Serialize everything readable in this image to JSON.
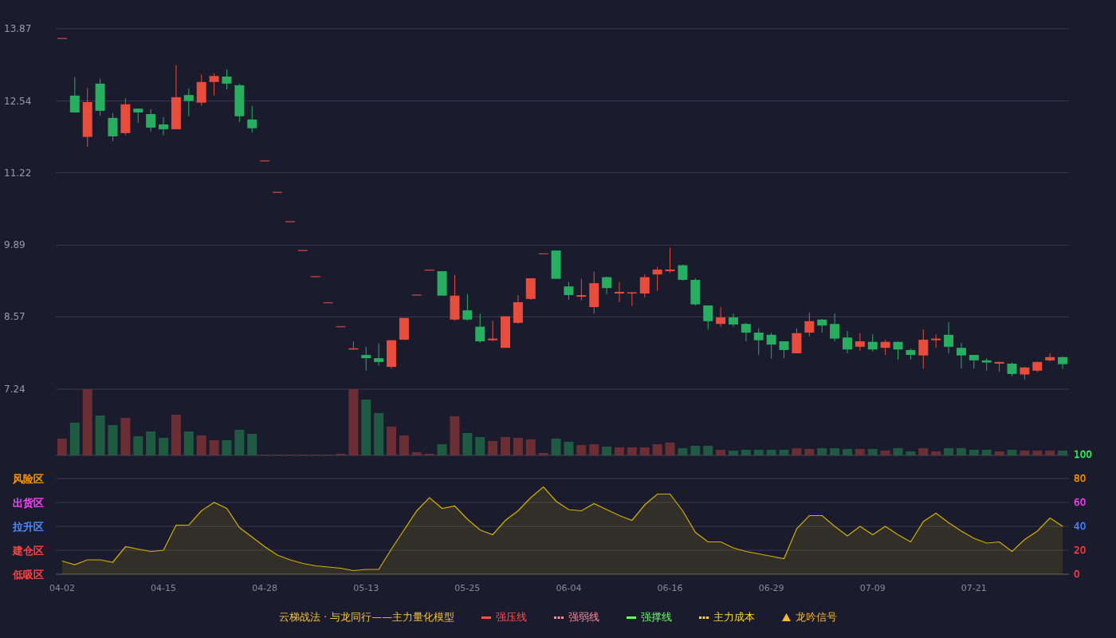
{
  "price_chart": {
    "chart_data": {
      "type": "candlestick",
      "grid": true,
      "ylim": [
        7.24,
        13.87
      ],
      "yticks": [
        {
          "value": 13.87,
          "label": "13.87"
        },
        {
          "value": 12.54,
          "label": "12.54"
        },
        {
          "value": 11.22,
          "label": "11.22"
        },
        {
          "value": 9.89,
          "label": "9.89"
        },
        {
          "value": 8.57,
          "label": "8.57"
        },
        {
          "value": 7.24,
          "label": "7.24"
        }
      ],
      "categories": [
        null,
        null,
        null,
        null,
        null,
        null,
        null,
        null,
        null,
        null,
        null,
        null,
        null,
        null,
        null,
        null,
        null,
        null,
        null,
        null,
        null,
        null,
        null,
        null,
        null,
        null,
        null,
        null,
        null,
        null,
        null,
        null,
        null,
        null,
        null,
        null,
        null,
        null,
        null,
        null,
        null,
        null,
        null,
        null,
        null,
        null,
        null,
        null,
        null,
        null,
        null,
        null,
        null,
        null,
        null,
        null,
        null,
        null,
        null,
        null,
        null,
        null,
        null,
        null,
        null,
        null,
        null,
        null,
        null,
        null,
        null,
        null,
        null,
        null,
        null,
        null,
        null,
        null,
        null,
        null
      ],
      "ohlc": [
        [
          13.69,
          13.69,
          13.69,
          13.69
        ],
        [
          12.64,
          12.98,
          12.32,
          12.33
        ],
        [
          11.88,
          12.78,
          11.7,
          12.52
        ],
        [
          12.86,
          12.95,
          12.27,
          12.36
        ],
        [
          12.23,
          12.32,
          11.8,
          11.89
        ],
        [
          11.95,
          12.59,
          11.91,
          12.48
        ],
        [
          12.4,
          12.4,
          12.14,
          12.33
        ],
        [
          12.3,
          12.39,
          11.98,
          12.05
        ],
        [
          12.11,
          12.24,
          11.91,
          12.02
        ],
        [
          12.02,
          13.2,
          12.02,
          12.61
        ],
        [
          12.65,
          12.77,
          12.26,
          12.54
        ],
        [
          12.51,
          13.03,
          12.45,
          12.89
        ],
        [
          12.89,
          13.05,
          12.64,
          13.0
        ],
        [
          12.99,
          13.12,
          12.75,
          12.86
        ],
        [
          12.83,
          12.86,
          12.15,
          12.26
        ],
        [
          12.2,
          12.45,
          11.96,
          12.04
        ],
        [
          11.44,
          11.44,
          11.44,
          11.44
        ],
        [
          10.86,
          10.86,
          10.86,
          10.86
        ],
        [
          10.32,
          10.32,
          10.32,
          10.32
        ],
        [
          9.79,
          9.79,
          9.79,
          9.79
        ],
        [
          9.31,
          9.31,
          9.31,
          9.31
        ],
        [
          8.83,
          8.83,
          8.83,
          8.83
        ],
        [
          8.39,
          8.39,
          8.39,
          8.39
        ],
        [
          7.97,
          8.12,
          7.97,
          7.99
        ],
        [
          7.87,
          8.02,
          7.58,
          7.81
        ],
        [
          7.81,
          8.08,
          7.67,
          7.74
        ],
        [
          7.65,
          8.14,
          7.62,
          8.14
        ],
        [
          8.15,
          8.55,
          8.14,
          8.55
        ],
        [
          8.97,
          8.97,
          8.97,
          8.97
        ],
        [
          9.43,
          9.43,
          9.43,
          9.43
        ],
        [
          9.41,
          9.41,
          8.96,
          8.96
        ],
        [
          8.52,
          9.34,
          8.5,
          8.96
        ],
        [
          8.69,
          8.99,
          8.5,
          8.52
        ],
        [
          8.39,
          8.63,
          8.09,
          8.12
        ],
        [
          8.14,
          8.5,
          8.12,
          8.17
        ],
        [
          8.0,
          8.58,
          8.0,
          8.58
        ],
        [
          8.46,
          8.97,
          8.44,
          8.84
        ],
        [
          8.9,
          9.28,
          8.88,
          9.28
        ],
        [
          9.73,
          9.73,
          9.73,
          9.73
        ],
        [
          9.79,
          9.79,
          9.27,
          9.27
        ],
        [
          9.13,
          9.21,
          8.88,
          8.97
        ],
        [
          8.94,
          9.27,
          8.87,
          8.97
        ],
        [
          8.75,
          9.4,
          8.63,
          9.19
        ],
        [
          9.3,
          9.31,
          8.99,
          9.1
        ],
        [
          9.0,
          9.21,
          8.84,
          9.03
        ],
        [
          9.0,
          9.03,
          8.77,
          9.02
        ],
        [
          9.0,
          9.35,
          8.93,
          9.3
        ],
        [
          9.35,
          9.49,
          9.05,
          9.44
        ],
        [
          9.41,
          9.84,
          9.38,
          9.44
        ],
        [
          9.52,
          9.53,
          9.24,
          9.25
        ],
        [
          9.25,
          9.28,
          8.78,
          8.8
        ],
        [
          8.78,
          8.78,
          8.34,
          8.49
        ],
        [
          8.44,
          8.75,
          8.39,
          8.56
        ],
        [
          8.56,
          8.63,
          8.39,
          8.43
        ],
        [
          8.44,
          8.46,
          8.12,
          8.28
        ],
        [
          8.28,
          8.36,
          7.87,
          8.14
        ],
        [
          8.24,
          8.28,
          7.8,
          8.06
        ],
        [
          8.12,
          8.12,
          7.81,
          7.96
        ],
        [
          7.9,
          8.36,
          7.9,
          8.27
        ],
        [
          8.28,
          8.65,
          8.21,
          8.49
        ],
        [
          8.52,
          8.53,
          8.28,
          8.41
        ],
        [
          8.44,
          8.63,
          8.12,
          8.17
        ],
        [
          8.19,
          8.31,
          7.9,
          7.97
        ],
        [
          8.02,
          8.27,
          7.95,
          8.12
        ],
        [
          8.11,
          8.25,
          7.93,
          7.97
        ],
        [
          8.0,
          8.15,
          7.87,
          8.11
        ],
        [
          8.11,
          8.12,
          7.78,
          7.97
        ],
        [
          7.96,
          7.99,
          7.78,
          7.87
        ],
        [
          7.86,
          8.34,
          7.62,
          8.15
        ],
        [
          8.14,
          8.25,
          8.0,
          8.17
        ],
        [
          8.24,
          8.47,
          7.9,
          8.02
        ],
        [
          8.0,
          8.09,
          7.62,
          7.86
        ],
        [
          7.87,
          7.87,
          7.62,
          7.77
        ],
        [
          7.77,
          7.81,
          7.58,
          7.73
        ],
        [
          7.71,
          7.75,
          7.56,
          7.74
        ],
        [
          7.71,
          7.73,
          7.48,
          7.52
        ],
        [
          7.51,
          7.65,
          7.42,
          7.64
        ],
        [
          7.58,
          7.75,
          7.55,
          7.74
        ],
        [
          7.77,
          7.9,
          7.75,
          7.83
        ],
        [
          7.83,
          7.84,
          7.61,
          7.7
        ]
      ]
    }
  },
  "indicator_chart": {
    "zones": [
      {
        "label": "风险区",
        "color": "#ff9900"
      },
      {
        "label": "出货区",
        "color": "#ff44ff"
      },
      {
        "label": "拉升区",
        "color": "#4d8cff"
      },
      {
        "label": "建仓区",
        "color": "#ff4444"
      },
      {
        "label": "低吸区",
        "color": "#ff4444"
      }
    ],
    "chart_data": {
      "type": "area",
      "grid": true,
      "ylim": [
        0,
        100
      ],
      "yticks": [
        {
          "value": 100,
          "label": "100"
        },
        {
          "value": 80,
          "label": "80"
        },
        {
          "value": 60,
          "label": "60"
        },
        {
          "value": 40,
          "label": "40"
        },
        {
          "value": 20,
          "label": "20"
        },
        {
          "value": 0,
          "label": "0"
        }
      ],
      "categories": [
        "04-02",
        null,
        null,
        null,
        null,
        null,
        null,
        null,
        "04-15",
        null,
        null,
        null,
        null,
        null,
        null,
        null,
        "04-28",
        null,
        null,
        null,
        null,
        null,
        null,
        null,
        "05-13",
        null,
        null,
        null,
        null,
        null,
        null,
        null,
        "05-25",
        null,
        null,
        null,
        null,
        null,
        null,
        null,
        "06-04",
        null,
        null,
        null,
        null,
        null,
        null,
        null,
        "06-16",
        null,
        null,
        null,
        null,
        null,
        null,
        null,
        "06-29",
        null,
        null,
        null,
        null,
        null,
        null,
        null,
        "07-09",
        null,
        null,
        null,
        null,
        null,
        null,
        null,
        "07-21",
        null,
        null,
        null,
        null,
        null,
        null,
        null
      ],
      "series": [
        {
          "color": "#d4b000",
          "values": [
            11,
            8,
            12,
            12,
            10,
            23,
            21,
            19,
            20,
            41,
            41,
            53,
            60,
            55,
            39,
            31,
            23,
            16,
            12,
            9,
            7,
            6,
            5,
            3,
            4,
            4,
            21,
            37,
            53,
            64,
            55,
            57,
            46,
            37,
            33,
            45,
            53,
            64,
            73,
            61,
            54,
            53,
            59,
            54,
            49,
            45,
            58,
            67,
            67,
            53,
            35,
            27,
            27,
            22,
            19,
            17,
            15,
            13,
            38,
            49,
            49,
            40,
            32,
            40,
            33,
            40,
            33,
            27,
            44,
            51,
            43,
            36,
            30,
            26,
            27,
            19,
            29,
            36,
            47,
            40
          ]
        }
      ]
    }
  },
  "legend": {
    "title": "云梯战法 · 与龙同行——主力量化模型",
    "items": [
      {
        "label": "强压线",
        "color": "#ff4d4d",
        "kind": "solid"
      },
      {
        "label": "强弱线",
        "color": "#ff8a9a",
        "kind": "dashed"
      },
      {
        "label": "强撑线",
        "color": "#66ff66",
        "kind": "solid"
      },
      {
        "label": "主力成本",
        "color": "#ffd633",
        "kind": "dashed"
      },
      {
        "label": "龙吟信号",
        "color": "#f5b82e",
        "kind": "triangle"
      }
    ]
  }
}
